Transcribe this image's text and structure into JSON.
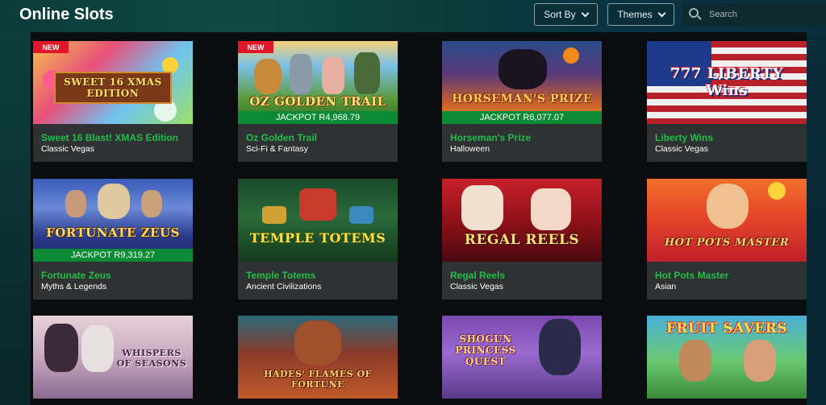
{
  "header": {
    "title": "Online Slots",
    "sort_label": "Sort By",
    "themes_label": "Themes",
    "search_placeholder": "Search"
  },
  "games": [
    {
      "name": "Sweet 16 Blast! XMAS Edition",
      "category": "Classic Vegas",
      "badge": "NEW",
      "jackpot": "",
      "art_text": "SWEET 16 XMAS EDITION"
    },
    {
      "name": "Oz Golden Trail",
      "category": "Sci-Fi & Fantasy",
      "badge": "NEW",
      "jackpot": "JACKPOT R4,968.79",
      "art_text": "OZ GOLDEN TRAIL"
    },
    {
      "name": "Horseman's Prize",
      "category": "Halloween",
      "badge": "",
      "jackpot": "JACKPOT R6,077.07",
      "art_text": "HORSEMAN'S PRIZE"
    },
    {
      "name": "Liberty Wins",
      "category": "Classic Vegas",
      "badge": "",
      "jackpot": "",
      "art_text": "777 LIBERTY Wins"
    },
    {
      "name": "Fortunate Zeus",
      "category": "Myths & Legends",
      "badge": "",
      "jackpot": "JACKPOT R9,319.27",
      "art_text": "FORTUNATE ZEUS"
    },
    {
      "name": "Temple Totems",
      "category": "Ancient Civilizations",
      "badge": "",
      "jackpot": "",
      "art_text": "TEMPLE TOTEMS"
    },
    {
      "name": "Regal Reels",
      "category": "Classic Vegas",
      "badge": "",
      "jackpot": "",
      "art_text": "REGAL REELS"
    },
    {
      "name": "Hot Pots Master",
      "category": "Asian",
      "badge": "",
      "jackpot": "",
      "art_text": "HOT POTS MASTER"
    },
    {
      "name": "",
      "category": "",
      "badge": "",
      "jackpot": "",
      "art_text": "WHISPERS OF SEASONS"
    },
    {
      "name": "",
      "category": "",
      "badge": "",
      "jackpot": "",
      "art_text": "HADES' FLAMES OF FORTUNE"
    },
    {
      "name": "",
      "category": "",
      "badge": "",
      "jackpot": "",
      "art_text": "SHOGUN PRINCESS QUEST"
    },
    {
      "name": "",
      "category": "",
      "badge": "",
      "jackpot": "",
      "art_text": "FRUIT SAVERS"
    }
  ],
  "colors": {
    "accent_green": "#1fbf4a",
    "jackpot_green": "#0d8a35",
    "new_badge_red": "#e0172b",
    "card_bg": "#303132"
  },
  "icons": {
    "search": "search-icon",
    "dropdown": "chevron-down-icon"
  }
}
